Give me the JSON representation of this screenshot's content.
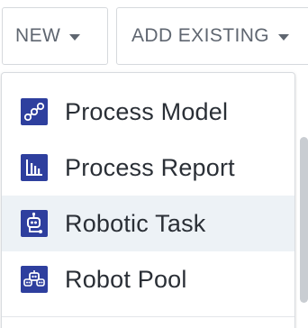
{
  "toolbar": {
    "new_label": "NEW",
    "add_existing_label": "ADD EXISTING"
  },
  "menu": {
    "items": [
      {
        "label": "Process Model",
        "icon": "process-model-icon"
      },
      {
        "label": "Process Report",
        "icon": "process-report-icon"
      },
      {
        "label": "Robotic Task",
        "icon": "robotic-task-icon",
        "highlighted": true
      },
      {
        "label": "Robot Pool",
        "icon": "robot-pool-icon"
      }
    ]
  },
  "colors": {
    "icon_blue": "#2e3f9e",
    "highlight_bg": "#edf2f6",
    "text": "#2a2f36",
    "toolbar_text": "#5f6670"
  }
}
